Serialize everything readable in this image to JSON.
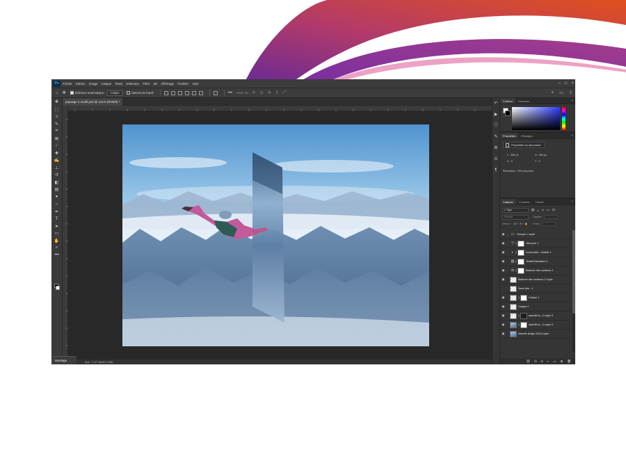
{
  "menubar": {
    "app_icon": "Ps",
    "items": [
      "Fichier",
      "Edition",
      "Image",
      "Calque",
      "Texte",
      "Sélection",
      "Filtre",
      "3D",
      "Affichage",
      "Fenêtre",
      "Aide"
    ]
  },
  "options": {
    "auto_select_label": "Sélection automatique :",
    "auto_select_value": "Calque",
    "transform_label": "Options de transf.",
    "mode_3d_label": "Mode 3D :"
  },
  "document": {
    "tab_title": "paysage 4 modif.psd @ 121% (RVB/8) *",
    "status": "Doc : 1,47 Mo/91,3 Mo",
    "workspace_label": "Montage"
  },
  "panels": {
    "color_tabs": [
      "Couleur",
      "Nuancier"
    ],
    "props_tabs": [
      "Propriétés",
      "Réglages"
    ],
    "props_title": "Propriétés du document",
    "width": "L : 366 px",
    "height": "H : 400 px",
    "x": "X : 0",
    "y": "Y : 0",
    "resolution": "Résolution : 300 px/pouce",
    "layers_tabs": [
      "Calques",
      "Couches",
      "Tracés"
    ],
    "layers_filter": "Type",
    "blend_mode": "Normal",
    "opacity_label": "Opacité :",
    "lock_label": "Verrou :",
    "fill_label": "Fond :"
  },
  "layers": [
    {
      "name": "Groupe 1 copie",
      "kind": "group"
    },
    {
      "name": "Vibrance 1",
      "kind": "adjust",
      "icon": "triangle-down-icon"
    },
    {
      "name": "Luminosité...ntraste 1",
      "kind": "adjust",
      "icon": "half-circle-icon"
    },
    {
      "name": "Teinte/Saturation 1",
      "kind": "adjust",
      "icon": "hue-sat-icon"
    },
    {
      "name": "Balance des couleurs 1",
      "kind": "adjust",
      "icon": "balance-icon"
    },
    {
      "name": "Balance des couleurs 2 copie",
      "kind": "image"
    },
    {
      "name": "Sans titre - 1",
      "kind": "plain"
    },
    {
      "name": "Calque 1",
      "kind": "masked"
    },
    {
      "name": "Calque 2",
      "kind": "plain"
    },
    {
      "name": "damnitt la...4 copie 3",
      "kind": "masked"
    },
    {
      "name": "damnitt la...4 copie 2",
      "kind": "masked"
    },
    {
      "name": "damnitt-langer-3024 copie",
      "kind": "image"
    }
  ],
  "colors": {
    "ps_dark": "#2b2b2b",
    "ps_panel": "#353535",
    "swoosh_orange": "#e0501c",
    "swoosh_purple": "#6b2a94"
  }
}
